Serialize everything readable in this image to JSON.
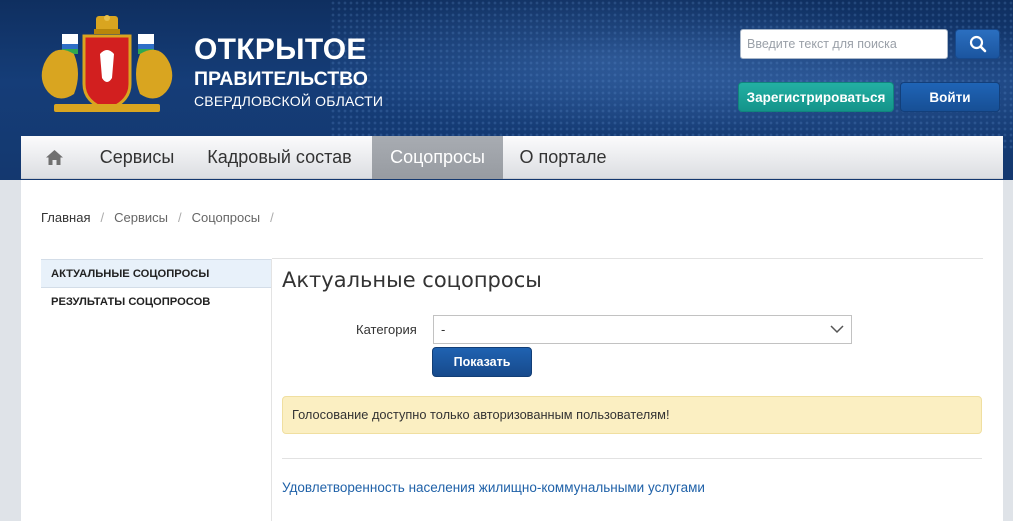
{
  "header": {
    "brand_line1": "ОТКРЫТОЕ",
    "brand_line2": "ПРАВИТЕЛЬСТВО",
    "brand_line3": "СВЕРДЛОВСКОЙ ОБЛАСТИ",
    "search_placeholder": "Введите текст для поиска",
    "search_icon": "search-icon",
    "register_label": "Зарегистрироваться",
    "login_label": "Войти",
    "logo_icon": "coat-of-arms-icon"
  },
  "nav": {
    "home_icon": "home-icon",
    "items": [
      {
        "label": "Сервисы",
        "active": false
      },
      {
        "label": "Кадровый состав",
        "active": false
      },
      {
        "label": "Соцопросы",
        "active": true
      },
      {
        "label": "О портале",
        "active": false
      }
    ]
  },
  "breadcrumb": {
    "items": [
      "Главная",
      "Сервисы",
      "Соцопросы"
    ],
    "separator": "/"
  },
  "sidebar": {
    "items": [
      {
        "label": "АКТУАЛЬНЫЕ СОЦОПРОСЫ",
        "active": true
      },
      {
        "label": "РЕЗУЛЬТАТЫ СОЦОПРОСОВ",
        "active": false
      }
    ]
  },
  "main": {
    "title": "Актуальные соцопросы",
    "category_label": "Категория",
    "category_value": "-",
    "show_label": "Показать",
    "alert_text": "Голосование доступно только авторизованным пользователям!",
    "poll_link": "Удовлетворенность населения жилищно-коммунальными услугами"
  },
  "colors": {
    "header_bg": "#153d78",
    "register_green": "#1aa397",
    "primary_blue": "#1b559f",
    "alert_bg": "#fbefc2",
    "link_blue": "#1f61a8"
  }
}
